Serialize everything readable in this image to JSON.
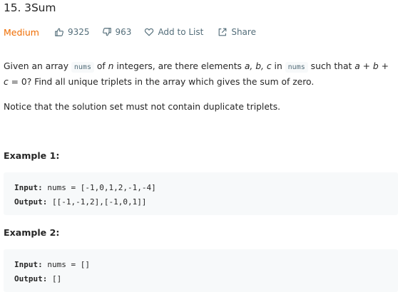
{
  "problem": {
    "title": "15. 3Sum",
    "difficulty": "Medium",
    "likes": "9325",
    "dislikes": "963",
    "add_to_list": "Add to List",
    "share": "Share"
  },
  "description": {
    "p1_text1": "Given an array ",
    "p1_code1": "nums",
    "p1_text2": " of ",
    "p1_var_n": "n",
    "p1_text3": " integers, are there elements ",
    "p1_vars_abc": "a, b, c",
    "p1_text4": " in ",
    "p1_code2": "nums",
    "p1_text5": " such that ",
    "p1_expr": "a + b + c",
    "p1_text6": " = 0? Find all unique triplets in the array which gives the sum of zero.",
    "p2": "Notice that the solution set must not contain duplicate triplets."
  },
  "examples": [
    {
      "heading": "Example 1:",
      "input_label": "Input:",
      "input_value": " nums = [-1,0,1,2,-1,-4]",
      "output_label": "Output:",
      "output_value": " [[-1,-1,2],[-1,0,1]]"
    },
    {
      "heading": "Example 2:",
      "input_label": "Input:",
      "input_value": " nums = []",
      "output_label": "Output:",
      "output_value": " []"
    }
  ],
  "colors": {
    "difficulty_medium": "#ef6c00",
    "meta_text": "#546e7a",
    "code_bg": "#f7f9fa"
  },
  "icons": {
    "likes": "thumbs-up-icon",
    "dislikes": "thumbs-down-icon",
    "add_to_list": "heart-icon",
    "share": "share-icon"
  }
}
